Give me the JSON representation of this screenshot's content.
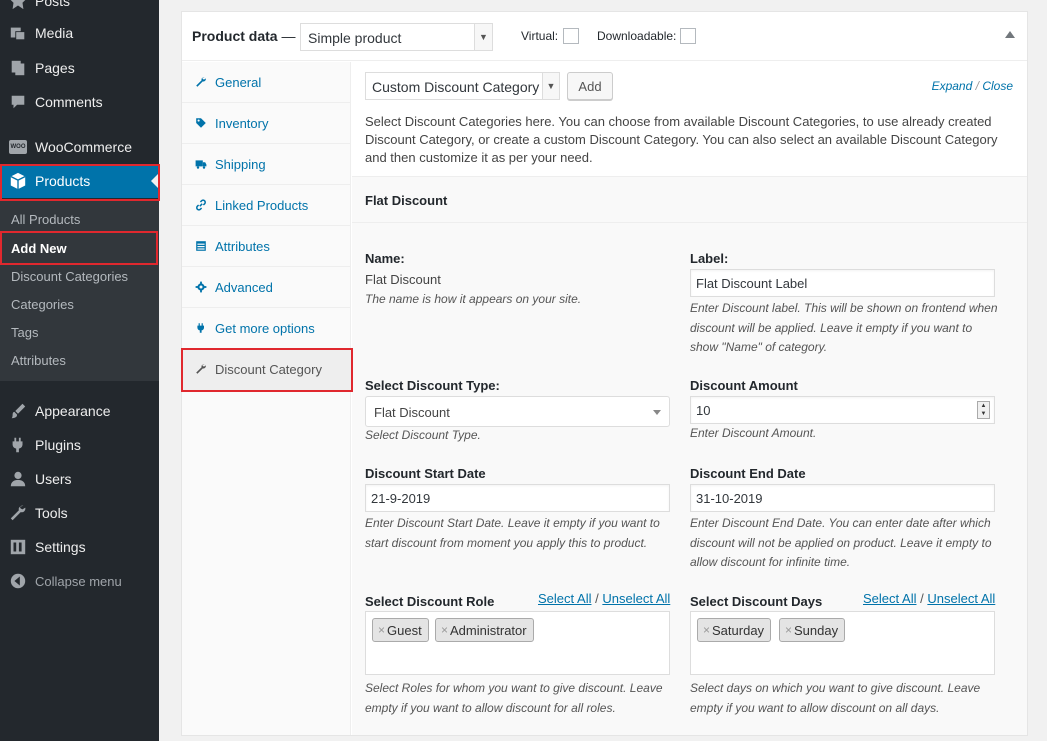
{
  "sidebar": {
    "posts": "Posts",
    "media": "Media",
    "pages": "Pages",
    "comments": "Comments",
    "woocommerce": "WooCommerce",
    "woo_badge": "WOO",
    "products": "Products",
    "submenu": [
      "All Products",
      "Add New",
      "Discount Categories",
      "Categories",
      "Tags",
      "Attributes"
    ],
    "appearance": "Appearance",
    "plugins": "Plugins",
    "users": "Users",
    "tools": "Tools",
    "settings": "Settings",
    "collapse": "Collapse menu"
  },
  "product_data": {
    "title": "Product data",
    "dash": "—",
    "type_value": "Simple product",
    "virtual_label": "Virtual:",
    "downloadable_label": "Downloadable:",
    "tabs": [
      "General",
      "Inventory",
      "Shipping",
      "Linked Products",
      "Attributes",
      "Advanced",
      "Get more options",
      "Discount Category"
    ]
  },
  "panel": {
    "category_select": "Custom Discount Category",
    "add_button": "Add",
    "expand": "Expand",
    "close": "Close",
    "description": "Select Discount Categories here. You can choose from available Discount Categories, to use already created Discount Category, or create a custom Discount Category. You can also select an available Discount Category and then customize it as per your need.",
    "block_title": "Flat Discount",
    "name_label": "Name:",
    "name_value": "Flat Discount",
    "name_desc": "The name is how it appears on your site.",
    "label_label": "Label:",
    "label_value": "Flat Discount Label",
    "label_desc": "Enter Discount label. This will be shown on frontend when discount will be applied. Leave it empty if you want to show \"Name\" of category.",
    "type_label": "Select Discount Type:",
    "type_value": "Flat Discount",
    "type_desc": "Select Discount Type.",
    "amount_label": "Discount Amount",
    "amount_value": "10",
    "amount_desc": "Enter Discount Amount.",
    "start_label": "Discount Start Date",
    "start_value": "21-9-2019",
    "start_desc": "Enter Discount Start Date. Leave it empty if you want to start discount from moment you apply this to product.",
    "end_label": "Discount End Date",
    "end_value": "31-10-2019",
    "end_desc": "Enter Discount End Date. You can enter date after which discount will not be applied on product. Leave it empty to allow discount for infinite time.",
    "role_label": "Select Discount Role",
    "roles": [
      "Guest",
      "Administrator"
    ],
    "role_desc": "Select Roles for whom you want to give discount. Leave empty if you want to allow discount for all roles.",
    "days_label": "Select Discount Days",
    "days": [
      "Saturday",
      "Sunday"
    ],
    "days_desc": "Select days on which you want to give discount. Leave empty if you want to allow discount on all days.",
    "select_all": "Select All",
    "unselect_all": "Unselect All",
    "slash": "/",
    "chip_x": "×"
  },
  "colors": {
    "admin_bg": "#23282d",
    "active_blue": "#0073aa",
    "highlight_red": "#e0282e"
  }
}
